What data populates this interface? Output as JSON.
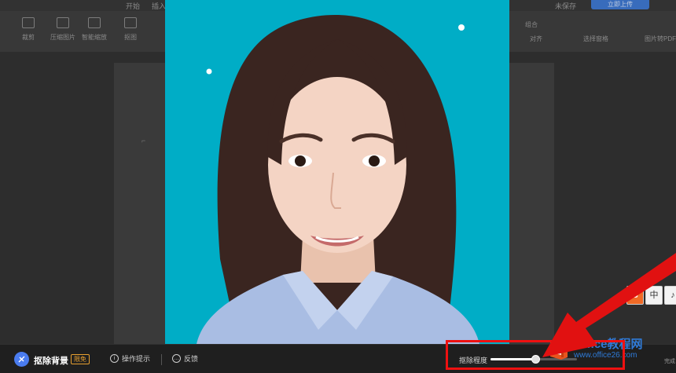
{
  "ribbon": {
    "tab_home": "开始",
    "tab_insert": "插入",
    "upload_label": "立即上传",
    "unsaved_label": "未保存",
    "tools": [
      "裁剪",
      "压缩图片",
      "智能缩放",
      "抠图"
    ],
    "right_tools": [
      "组合",
      "对齐",
      "选择窗格",
      "图片转PDF"
    ]
  },
  "bottom_bar": {
    "title": "抠除背景",
    "badge": "限免",
    "help_label": "操作提示",
    "feedback_label": "反馈",
    "degree_label": "抠除程度",
    "degree_value": 0.52
  },
  "watermark": {
    "line1": "Office教程网",
    "line2": "www.office26.com",
    "corner": "完成"
  },
  "ime": {
    "keys": [
      "S",
      "中",
      "♪"
    ]
  },
  "colors": {
    "photo_background": "#00adc6",
    "annotation": "#e11111",
    "slider_fill": "#ffffff"
  }
}
